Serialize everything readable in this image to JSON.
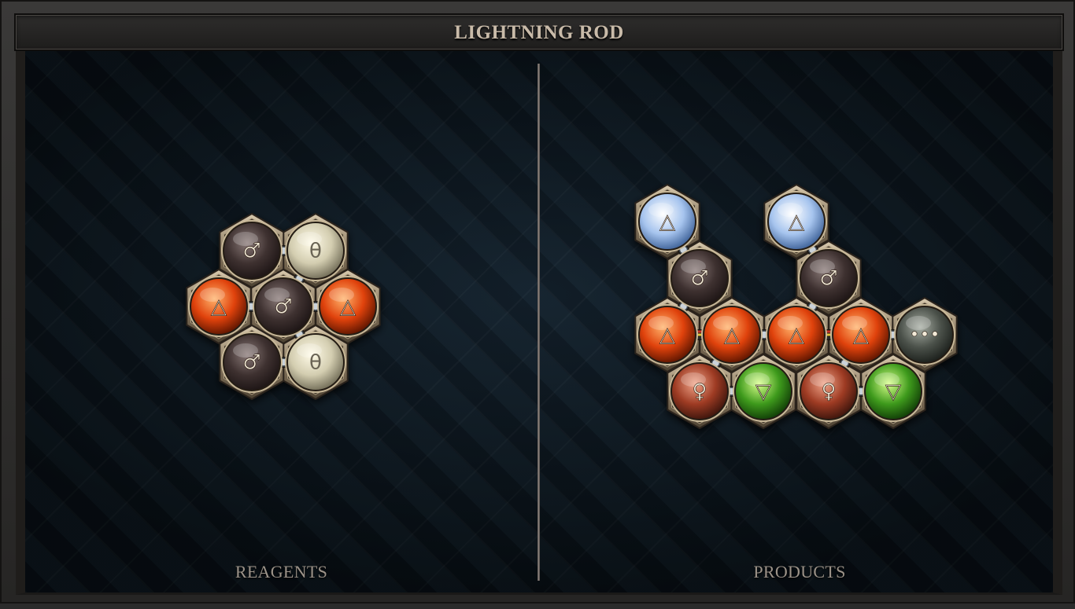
{
  "title": "LIGHTNING ROD",
  "reagents_label": "REAGENTS",
  "products_label": "PRODUCTS",
  "icons": {
    "board": "quilted-diamond-pattern",
    "molecule_frame": "bronze-hexagon-frame",
    "bond": "metal-pipe-bond",
    "triplex_bond": "colored-triplex-bond"
  },
  "elements": {
    "iron": {
      "symbol": "♂",
      "name": "iron",
      "colors": [
        "#8a7a78",
        "#3e3130",
        "#1c1414"
      ]
    },
    "salt": {
      "symbol": "θ",
      "name": "salt",
      "colors": [
        "#fffbe8",
        "#d3cdb0",
        "#6f6a55"
      ]
    },
    "fire": {
      "symbol": "△",
      "name": "fire",
      "colors": [
        "#ffb26a",
        "#e0420c",
        "#5a1400"
      ]
    },
    "air": {
      "symbol": "△",
      "name": "air",
      "colors": [
        "#ffffff",
        "#a6c4ee",
        "#3b5f96"
      ]
    },
    "copper": {
      "symbol": "♀",
      "name": "copper",
      "colors": [
        "#f0a58a",
        "#9e3b23",
        "#3a140c"
      ]
    },
    "earth": {
      "symbol": "▽",
      "name": "earth",
      "colors": [
        "#d8ff8a",
        "#3e9a1c",
        "#0f3a06"
      ]
    },
    "quintessence": {
      "symbol": "•••",
      "name": "quintessence",
      "colors": [
        "#a8aea4",
        "#4b514a",
        "#1a1e1a"
      ]
    }
  },
  "reagents": [
    {
      "atoms": [
        {
          "id": "r1",
          "element": "iron"
        },
        {
          "id": "r2",
          "element": "salt"
        },
        {
          "id": "r3",
          "element": "fire"
        },
        {
          "id": "r4",
          "element": "iron"
        },
        {
          "id": "r5",
          "element": "fire"
        },
        {
          "id": "r6",
          "element": "iron"
        },
        {
          "id": "r7",
          "element": "salt"
        }
      ],
      "bonds": [
        {
          "a": "r1",
          "b": "r2"
        },
        {
          "a": "r2",
          "b": "r4"
        },
        {
          "a": "r3",
          "b": "r4"
        },
        {
          "a": "r4",
          "b": "r5"
        },
        {
          "a": "r4",
          "b": "r7"
        },
        {
          "a": "r6",
          "b": "r7"
        }
      ]
    }
  ],
  "products": [
    {
      "atoms": [
        {
          "id": "p1",
          "element": "air"
        },
        {
          "id": "p2",
          "element": "iron"
        },
        {
          "id": "p3",
          "element": "fire"
        },
        {
          "id": "p4",
          "element": "fire"
        },
        {
          "id": "p5",
          "element": "copper"
        },
        {
          "id": "p6",
          "element": "earth"
        },
        {
          "id": "p7",
          "element": "air"
        },
        {
          "id": "p8",
          "element": "iron"
        },
        {
          "id": "p9",
          "element": "fire"
        },
        {
          "id": "p10",
          "element": "fire"
        },
        {
          "id": "p11",
          "element": "quintessence"
        },
        {
          "id": "p12",
          "element": "copper"
        },
        {
          "id": "p13",
          "element": "earth"
        }
      ],
      "bonds": [
        {
          "a": "p1",
          "b": "p2",
          "type": "normal"
        },
        {
          "a": "p2",
          "b": "p3",
          "type": "normal"
        },
        {
          "a": "p3",
          "b": "p4",
          "type": "triplex"
        },
        {
          "a": "p4",
          "b": "p5",
          "type": "normal"
        },
        {
          "a": "p5",
          "b": "p6",
          "type": "normal"
        },
        {
          "a": "p4",
          "b": "p9",
          "type": "normal"
        },
        {
          "a": "p7",
          "b": "p8",
          "type": "normal"
        },
        {
          "a": "p8",
          "b": "p9",
          "type": "normal"
        },
        {
          "a": "p9",
          "b": "p10",
          "type": "triplex"
        },
        {
          "a": "p10",
          "b": "p11",
          "type": "normal"
        },
        {
          "a": "p10",
          "b": "p12",
          "type": "normal"
        },
        {
          "a": "p12",
          "b": "p13",
          "type": "normal"
        }
      ]
    }
  ]
}
